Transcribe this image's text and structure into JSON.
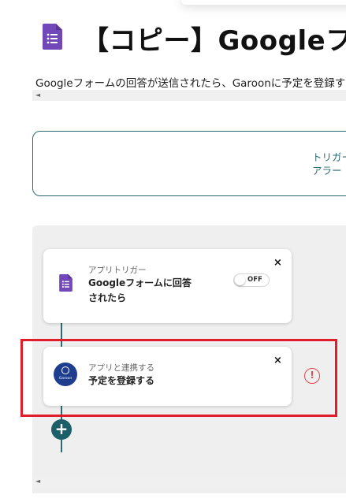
{
  "header": {
    "title": "【コピー】Googleフォームの回答が送信されたら、Garoonに予定を登録する",
    "description": "Googleフォームの回答が送信されたら、Garoonに予定を登録する",
    "app_icon": "google-forms-icon"
  },
  "info_box": {
    "line1": "トリガー",
    "line2": "アラー"
  },
  "flow": {
    "trigger_step": {
      "type_label": "アプリトリガー",
      "title_line1": "Googleフォームに回答",
      "title_line2": "されたら",
      "toggle_label": "OFF",
      "icon": "google-forms-icon",
      "close_label": "×"
    },
    "action_step": {
      "type_label": "アプリと連携する",
      "title": "予定を登録する",
      "icon": "garoon-icon",
      "logo_text": "Garoon",
      "close_label": "×",
      "warning_label": "!"
    },
    "add_label": "+"
  },
  "colors": {
    "accent": "#2b6a73",
    "forms_purple": "#7248b9",
    "garoon_blue": "#1f3d8f",
    "highlight_red": "#e11d2a",
    "warning_red": "#e5484d"
  },
  "scroll": {
    "left_arrow": "◄"
  }
}
